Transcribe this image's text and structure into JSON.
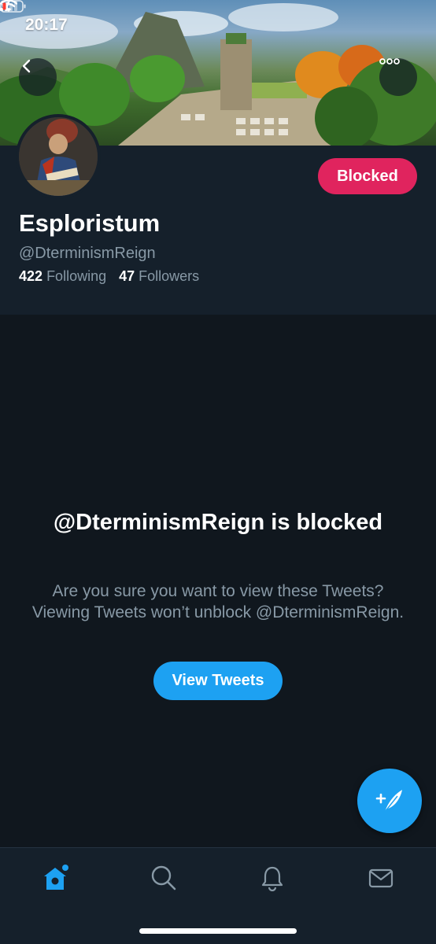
{
  "status_bar": {
    "time": "20:17"
  },
  "profile": {
    "display_name": "Esploristum",
    "handle": "@DterminismReign",
    "following_count": "422",
    "following_label": "Following",
    "followers_count": "47",
    "followers_label": "Followers",
    "blocked_button": "Blocked"
  },
  "blocked_notice": {
    "title": "@DterminismReign is blocked",
    "description": "Are you sure you want to view these Tweets? Viewing Tweets won’t unblock @DterminismReign.",
    "view_button": "View Tweets"
  },
  "bottom_nav": {
    "items": [
      {
        "icon": "home-icon",
        "active": true
      },
      {
        "icon": "search-icon",
        "active": false
      },
      {
        "icon": "bell-icon",
        "active": false
      },
      {
        "icon": "mail-icon",
        "active": false
      }
    ]
  },
  "colors": {
    "accent": "#1da1f2",
    "blocked": "#e0245e",
    "background": "#10171e",
    "header_bg": "#15202b",
    "secondary_text": "#8899a6"
  }
}
